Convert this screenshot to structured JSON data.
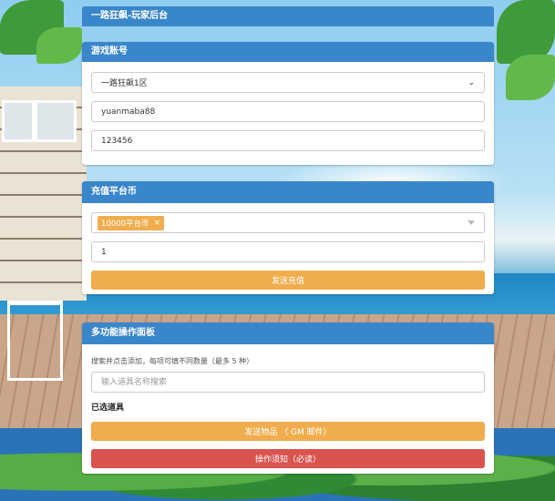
{
  "header": {
    "title": "一路狂飙-玩家后台"
  },
  "account_panel": {
    "title": "游戏账号",
    "server_select": {
      "value": "一路狂飙1区"
    },
    "username_input": {
      "value": "yuanmaba88"
    },
    "password_input": {
      "value": "123456"
    }
  },
  "recharge_panel": {
    "title": "充值平台币",
    "selected_tag": {
      "label": "10000平台币",
      "remove": "×"
    },
    "quantity_input": {
      "value": "1"
    },
    "submit_button": {
      "label": "发送充值"
    }
  },
  "multi_panel": {
    "title": "多功能操作面板",
    "hint": "搜索并点击添加，每项可填不同数量（最多 5 种）",
    "search_input": {
      "placeholder": "输入道具名称搜索"
    },
    "selected_items_label": "已选道具",
    "send_button": {
      "label": "发送物品 （ GM 邮件）"
    },
    "notice_button": {
      "label": "操作须知（必读）"
    }
  },
  "colors": {
    "header_blue": "#3a86cb",
    "warning_orange": "#f0ad4e",
    "danger_red": "#d9534f"
  }
}
